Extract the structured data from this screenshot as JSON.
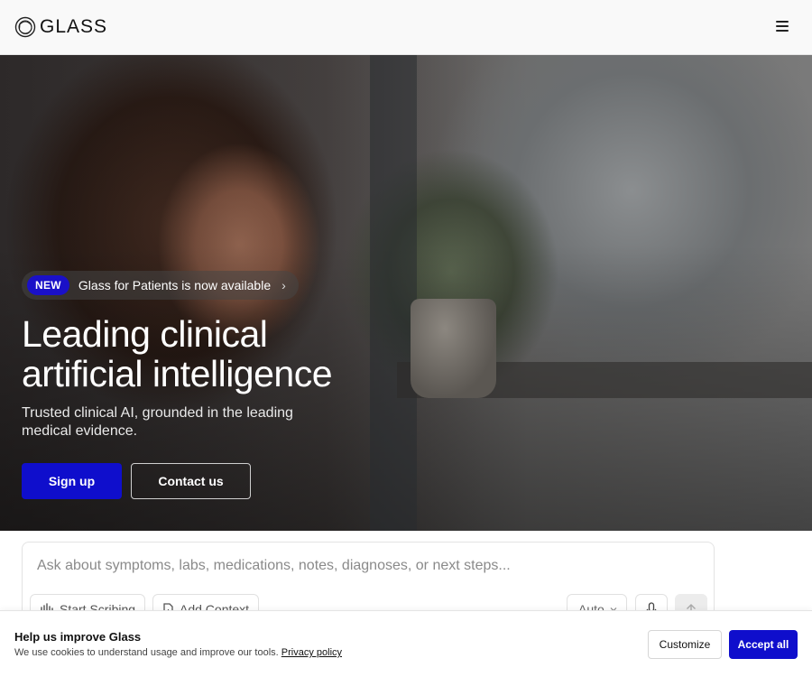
{
  "header": {
    "logo_text": "GLASS",
    "menu_icon": "hamburger-menu-icon"
  },
  "hero": {
    "announcement": {
      "badge": "NEW",
      "text": "Glass for Patients is now available",
      "chevron": "›"
    },
    "title_line1": "Leading clinical",
    "title_line2": "artificial intelligence",
    "subtitle": "Trusted clinical AI, grounded in the leading medical evidence.",
    "primary_button": "Sign up",
    "secondary_button": "Contact us"
  },
  "chat": {
    "placeholder": "Ask about symptoms, labs, medications, notes, diagnoses, or next steps...",
    "start_scribing": "Start Scribing",
    "add_context": "Add Context",
    "mode": "Auto"
  },
  "cookie": {
    "title": "Help us improve Glass",
    "text": "We use cookies to understand usage and improve our tools.",
    "link": "Privacy policy",
    "customize": "Customize",
    "accept": "Accept all"
  },
  "colors": {
    "brand_blue": "#0f0ecc",
    "header_bg": "#f9f9f9"
  }
}
